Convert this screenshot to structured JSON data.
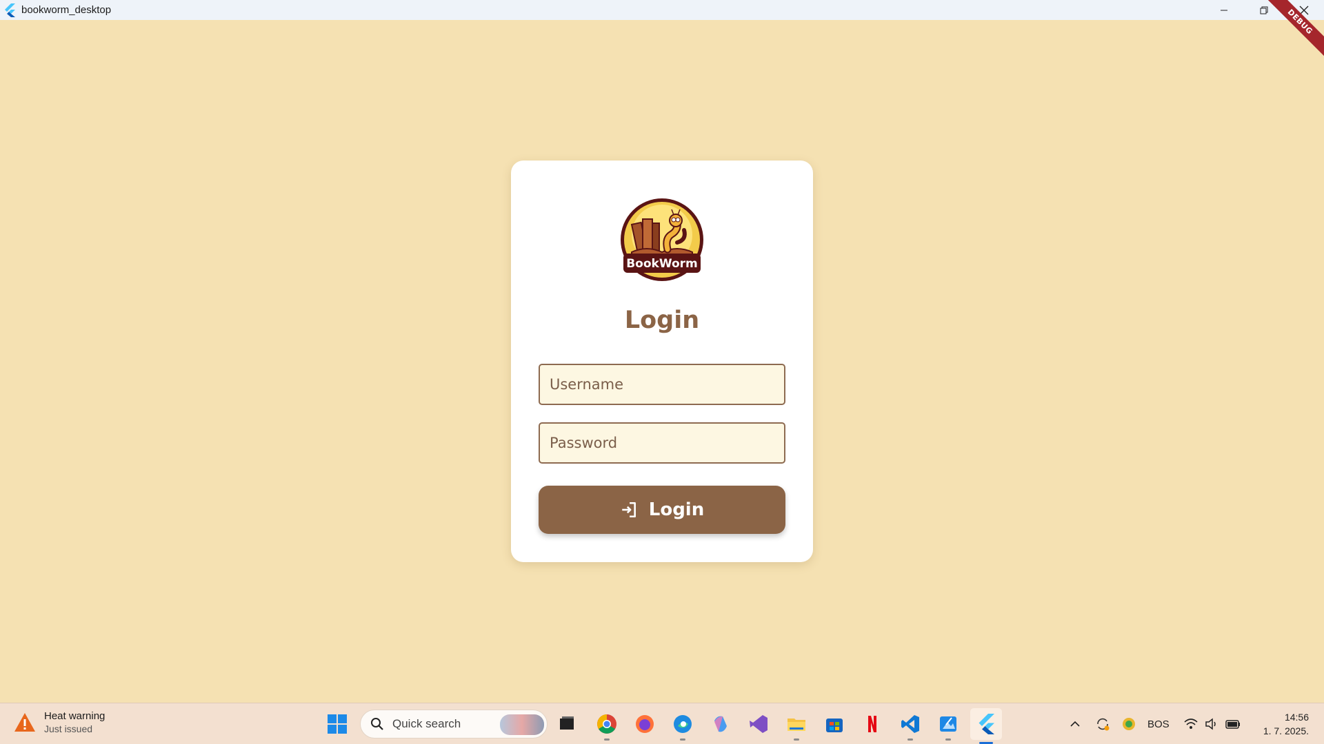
{
  "window": {
    "title": "bookworm_desktop",
    "debug_banner": "DEBUG"
  },
  "login": {
    "logo_text": "BookWorm",
    "title": "Login",
    "username_placeholder": "Username",
    "password_placeholder": "Password",
    "button_label": "Login"
  },
  "taskbar": {
    "notification_title": "Heat warning",
    "notification_subtitle": "Just issued",
    "search_label": "Quick search",
    "language": "BOS",
    "time": "14:56",
    "date": "1. 7. 2025."
  },
  "colors": {
    "background": "#f5e1b2",
    "accent": "#8b6446",
    "field_fill": "#fdf7e2",
    "debug": "#a5262c"
  }
}
